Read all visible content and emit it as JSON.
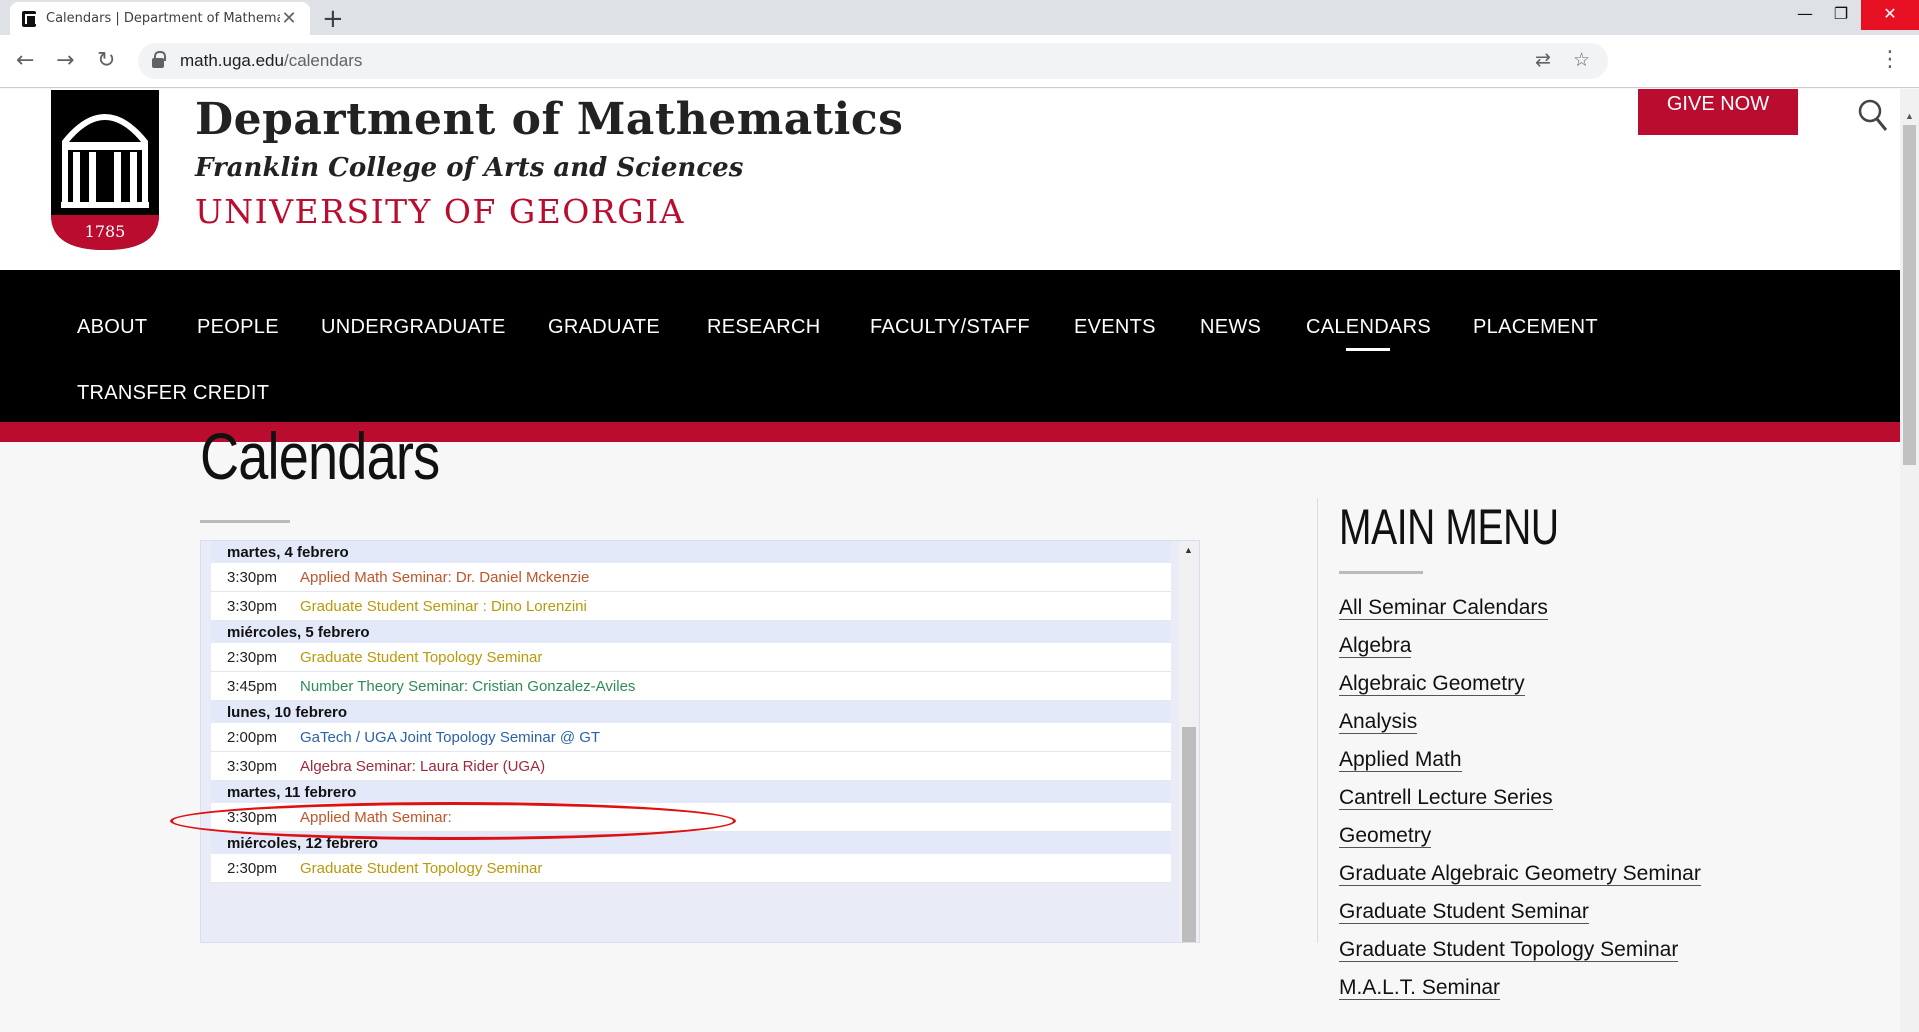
{
  "browser": {
    "tab_title": "Calendars | Department of Mathematics",
    "tab_close": "✕",
    "new_tab": "+",
    "url_host": "math.uga.edu",
    "url_path": "/calendars",
    "back": "←",
    "forward": "→",
    "reload": "↻",
    "translate_icon": "⇄",
    "star_icon": "☆",
    "menu": "⋮",
    "minimize": "—",
    "maximize": "❐",
    "close": "✕"
  },
  "header": {
    "seal_year": "1785",
    "dept_title": "Department of Mathematics",
    "college": "Franklin College of Arts and Sciences",
    "university": "UNIVERSITY OF GEORGIA",
    "give_now": "GIVE NOW"
  },
  "nav": {
    "items": [
      "ABOUT",
      "PEOPLE",
      "UNDERGRADUATE",
      "GRADUATE",
      "RESEARCH",
      "FACULTY/STAFF",
      "EVENTS",
      "NEWS",
      "CALENDARS",
      "PLACEMENT",
      "TRANSFER CREDIT"
    ],
    "active": "CALENDARS"
  },
  "main": {
    "title": "Calendars"
  },
  "calendar": {
    "days": [
      {
        "date": "martes, 4 febrero",
        "events": [
          {
            "time": "3:30pm",
            "title": "Applied Math Seminar: Dr. Daniel Mckenzie",
            "color": "#c0552a"
          },
          {
            "time": "3:30pm",
            "title": "Graduate Student Seminar : Dino Lorenzini",
            "color": "#b89a0a"
          }
        ]
      },
      {
        "date": "miércoles, 5 febrero",
        "events": [
          {
            "time": "2:30pm",
            "title": "Graduate Student Topology Seminar",
            "color": "#b89a0a"
          },
          {
            "time": "3:45pm",
            "title": "Number Theory Seminar: Cristian Gonzalez-Aviles",
            "color": "#2e8b57"
          }
        ]
      },
      {
        "date": "lunes, 10 febrero",
        "events": [
          {
            "time": "2:00pm",
            "title": "GaTech / UGA Joint Topology Seminar @ GT",
            "color": "#2b62a8"
          },
          {
            "time": "3:30pm",
            "title": "Algebra Seminar: Laura Rider (UGA)",
            "color": "#9b2a3a"
          }
        ]
      },
      {
        "date": "martes, 11 febrero",
        "events": [
          {
            "time": "3:30pm",
            "title": "Applied Math Seminar:",
            "color": "#c0552a"
          }
        ]
      },
      {
        "date": "miércoles, 12 febrero",
        "events": [
          {
            "time": "2:30pm",
            "title": "Graduate Student Topology Seminar",
            "color": "#b89a0a"
          }
        ]
      }
    ]
  },
  "sidebar": {
    "title": "MAIN MENU",
    "items": [
      "All Seminar Calendars",
      "Algebra",
      "Algebraic Geometry",
      "Analysis",
      "Applied Math",
      "Cantrell Lecture Series",
      "Geometry",
      "Graduate Algebraic Geometry Seminar",
      "Graduate Student Seminar",
      "Graduate Student Topology Seminar",
      "M.A.L.T. Seminar"
    ]
  }
}
